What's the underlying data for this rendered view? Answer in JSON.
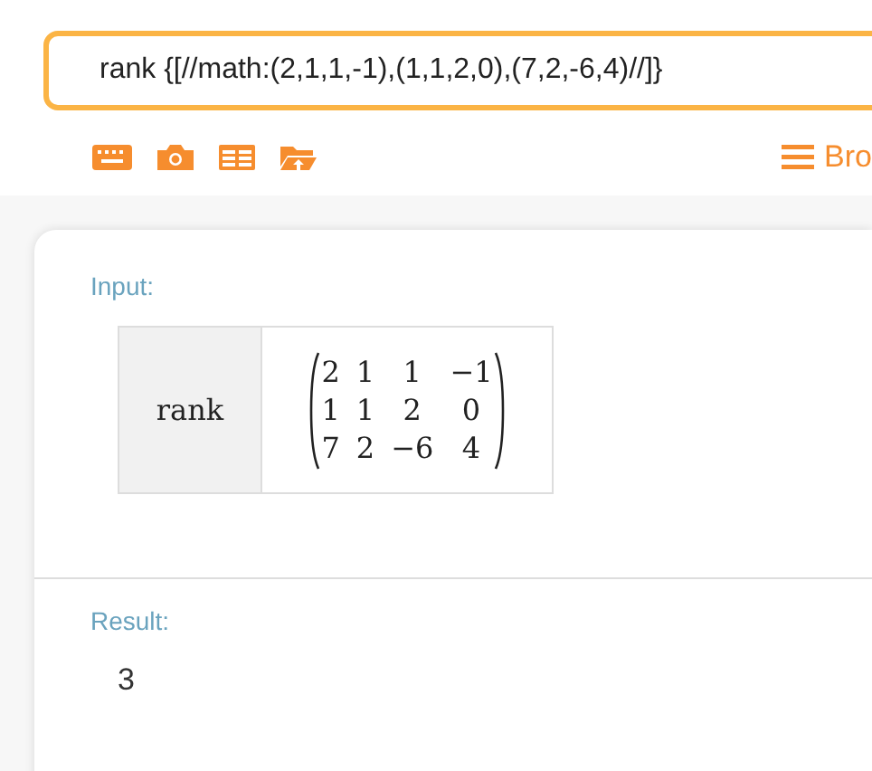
{
  "query": {
    "value": "rank {[//math:(2,1,1,-1),(1,1,2,0),(7,2,-6,4)//]}"
  },
  "toolbar": {
    "browse_label": "Bro"
  },
  "input_pod": {
    "label": "Input:",
    "function": "rank",
    "matrix": [
      [
        "2",
        "1",
        "1",
        "−1"
      ],
      [
        "1",
        "1",
        "2",
        "0"
      ],
      [
        "7",
        "2",
        "−6",
        "4"
      ]
    ]
  },
  "result_pod": {
    "label": "Result:",
    "value": "3"
  }
}
